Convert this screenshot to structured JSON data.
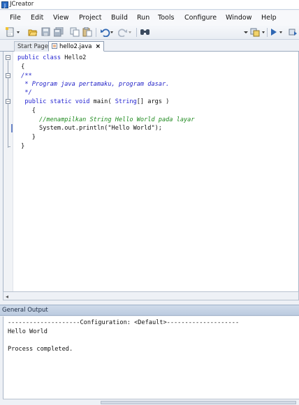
{
  "window": {
    "title": "JCreator"
  },
  "menu": [
    "File",
    "Edit",
    "View",
    "Project",
    "Build",
    "Run",
    "Tools",
    "Configure",
    "Window",
    "Help"
  ],
  "toolbar": {
    "icons": [
      "new-file-icon",
      "open-folder-icon",
      "save-icon",
      "save-all-icon",
      "copy-icon",
      "paste-icon",
      "undo-icon",
      "redo-icon",
      "find-icon",
      "build-icon",
      "run-icon"
    ]
  },
  "tabs": [
    {
      "label": "Start Page",
      "active": false
    },
    {
      "label": "hello2.java",
      "active": true,
      "close": "×"
    }
  ],
  "editor": {
    "lines": [
      {
        "indent": "",
        "tokens": [
          {
            "t": "kw",
            "v": "public class "
          },
          {
            "t": "pl",
            "v": "Hello2"
          }
        ]
      },
      {
        "indent": "",
        "tokens": [
          {
            "t": "pl",
            "v": " {"
          }
        ]
      },
      {
        "indent": "",
        "tokens": [
          {
            "t": "cm-doc",
            "v": " /**"
          }
        ]
      },
      {
        "indent": "",
        "tokens": [
          {
            "t": "cm-doc",
            "v": "  * Program java pertamaku, program dasar."
          }
        ]
      },
      {
        "indent": "",
        "tokens": [
          {
            "t": "cm-doc",
            "v": "  */"
          }
        ]
      },
      {
        "indent": "",
        "tokens": [
          {
            "t": "kw",
            "v": "  public static void "
          },
          {
            "t": "pl",
            "v": "main( "
          },
          {
            "t": "kw",
            "v": "String"
          },
          {
            "t": "pl",
            "v": "[] args )"
          }
        ]
      },
      {
        "indent": "",
        "tokens": [
          {
            "t": "pl",
            "v": "    {"
          }
        ]
      },
      {
        "indent": "",
        "tokens": [
          {
            "t": "cm",
            "v": "      //menampilkan String Hello World pada layar"
          }
        ]
      },
      {
        "indent": "",
        "tokens": [
          {
            "t": "pl",
            "v": "      System.out.println("
          },
          {
            "t": "str",
            "v": "\"Hello World\""
          },
          {
            "t": "pl",
            "v": ");"
          }
        ]
      },
      {
        "indent": "",
        "tokens": [
          {
            "t": "pl",
            "v": "    }"
          }
        ]
      },
      {
        "indent": "",
        "tokens": [
          {
            "t": "pl",
            "v": " }"
          }
        ]
      }
    ]
  },
  "output": {
    "header": "General Output",
    "lines": [
      "--------------------Configuration: <Default>--------------------",
      "Hello World",
      "",
      "Process completed."
    ]
  },
  "colors": {
    "keyword": "#1f1fd0",
    "comment": "#1f8a1f",
    "doc_comment": "#2323c8",
    "header_bg": "#c4d2e5"
  }
}
